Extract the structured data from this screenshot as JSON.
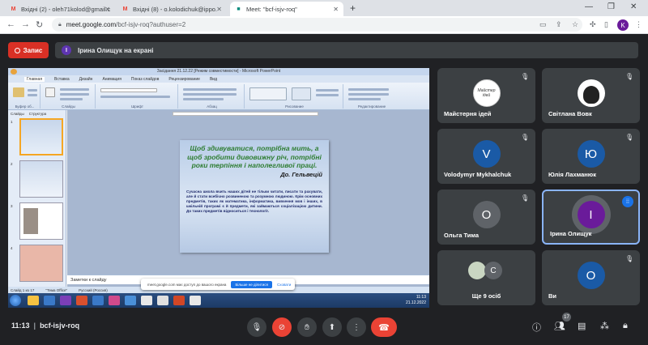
{
  "browser": {
    "tabs": [
      {
        "label": "Вхідні (2) - oleh71kolod@gmail.c",
        "icon": "gmail-icon"
      },
      {
        "label": "Вхідні (8) - o.kolodichuk@ippo.",
        "icon": "gmail-icon"
      },
      {
        "label": "Meet: \"bcf-isjv-roq\"",
        "icon": "meet-icon"
      }
    ],
    "new_tab": "+",
    "url_host": "meet.google.com",
    "url_path": "/bcf-isjv-roq?authuser=2",
    "profile_initial": "K"
  },
  "meet": {
    "record_label": "Запис",
    "presenter_initial": "І",
    "presenter_text": "Ірина Олищук на екрані",
    "time": "11:13",
    "meeting_code": "bcf-isjv-roq",
    "participants_count": "17",
    "colors": {
      "accent": "#1a73e8",
      "danger": "#ea4335",
      "surface": "#3c4043",
      "background": "#202124"
    }
  },
  "shared_screen": {
    "window_title": "Засідання 21.12.22 [Режим совместимости] - Microsoft PowerPoint",
    "ribbon_tabs": [
      "Главная",
      "Вставка",
      "Дизайн",
      "Анимация",
      "Показ слайдов",
      "Рецензирование",
      "Вид"
    ],
    "ribbon_groups": [
      "Буфер об...",
      "Слайды",
      "Шрифт",
      "Абзац",
      "Рисование",
      "Редактирование"
    ],
    "panel_tabs": [
      "Слайды",
      "Структура"
    ],
    "slide_quote": "Щоб здивуватися, потрібна мить, а щоб зробити дивовижну річ, потрібні роки терпіння і наполегливої праці.",
    "slide_author": "До. Гельвецій",
    "slide_body": "Сучасна школа вчить наших дітей не тільки читати, писати та рахувати, але й стати всебічно розвиненою та розумною людиною. Крім основних предметів, таких як математика, інформатика, вивчення мов і інших, в шкільній програмі є й предмети, які займаються соціалізацією дитини. До таких предметів відноситься і технології.",
    "notes_placeholder": "Заметки к слайду",
    "status": [
      "Слайд 1 из 17",
      "\"Тема Office\"",
      "Русский (Россия)"
    ],
    "clock_time": "11:13",
    "clock_date": "21.12.2022",
    "share_notice": "meet.google.com має доступ до вашого екрана",
    "share_stop": "Більше не ділитися",
    "share_hide": "Сховати"
  },
  "participants": [
    {
      "name": "Майстерня ідей",
      "initial": "",
      "color": "#ffffff",
      "muted": true
    },
    {
      "name": "Світлана Вовк",
      "initial": "",
      "color": "#ffffff",
      "muted": true
    },
    {
      "name": "Volodymyr Mykhalchuk",
      "initial": "V",
      "color": "#1a5aa6",
      "muted": true
    },
    {
      "name": "Юлія Лахманюк",
      "initial": "Ю",
      "color": "#1a5aa6",
      "muted": true
    },
    {
      "name": "Ольга Тима",
      "initial": "О",
      "color": "#5f6368",
      "muted": true
    },
    {
      "name": "Ірина Олищук",
      "initial": "І",
      "color": "#6a1b9a",
      "muted": false
    },
    {
      "name": "Ще 9 осіб",
      "initial": "С",
      "color": "#5f6368",
      "muted": false
    },
    {
      "name": "Ви",
      "initial": "О",
      "color": "#1a5aa6",
      "muted": true
    }
  ]
}
